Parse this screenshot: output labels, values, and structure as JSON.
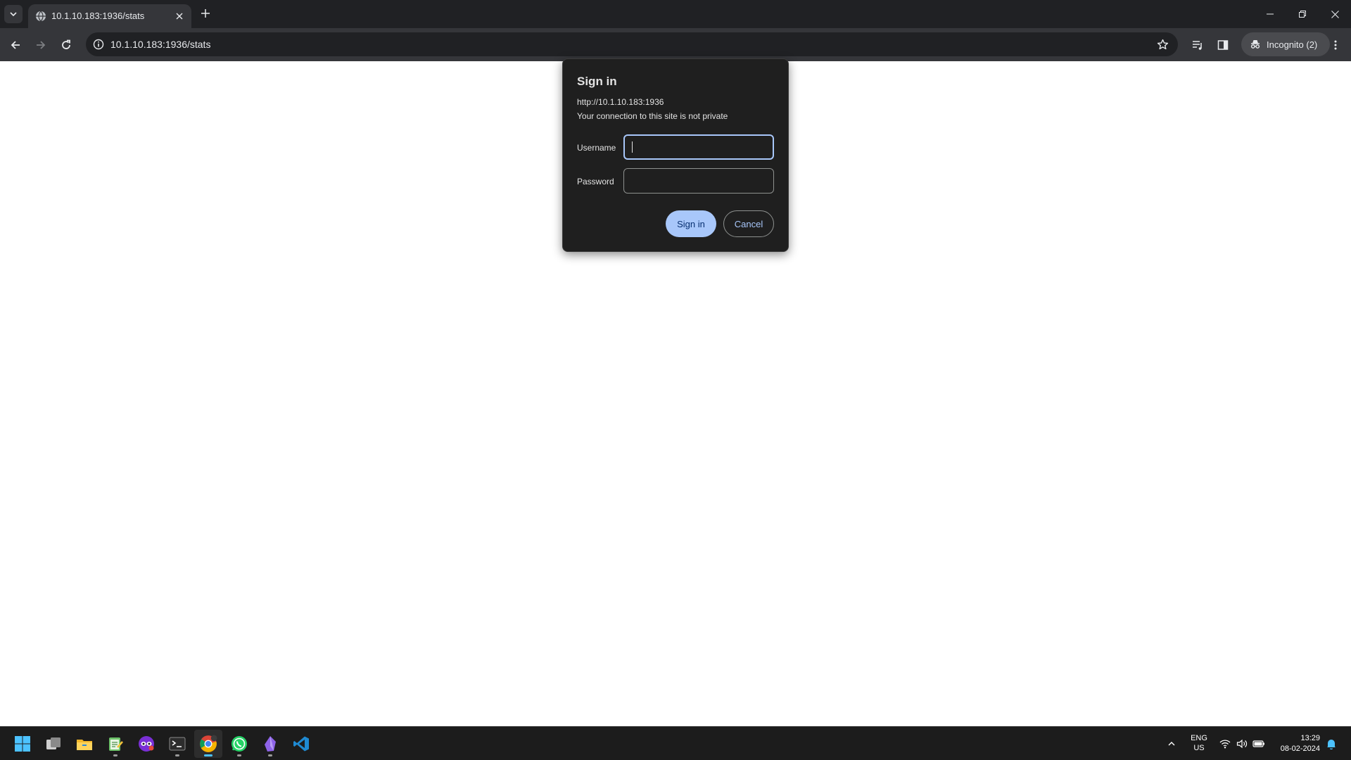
{
  "browser": {
    "tab": {
      "title": "10.1.10.183:1936/stats"
    },
    "address_bar": {
      "url": "10.1.10.183:1936/stats"
    },
    "incognito_label": "Incognito (2)"
  },
  "dialog": {
    "title": "Sign in",
    "origin": "http://10.1.10.183:1936",
    "warning": "Your connection to this site is not private",
    "username_label": "Username",
    "username_value": "",
    "password_label": "Password",
    "password_value": "",
    "signin_button": "Sign in",
    "cancel_button": "Cancel"
  },
  "taskbar": {
    "apps": [
      "start-icon",
      "task-view-icon",
      "file-explorer-icon",
      "notepad-icon",
      "mask-app-icon",
      "terminal-icon",
      "chrome-icon",
      "whatsapp-icon",
      "obsidian-icon",
      "vscode-icon"
    ],
    "language": {
      "line1": "ENG",
      "line2": "US"
    },
    "clock": {
      "time": "13:29",
      "date": "08-02-2024"
    }
  },
  "colors": {
    "tab_strip": "#202124",
    "toolbar": "#35363a",
    "dialog_bg": "#1f1f1f",
    "accent": "#a8c7fa",
    "taskbar": "#1c1c1c"
  }
}
